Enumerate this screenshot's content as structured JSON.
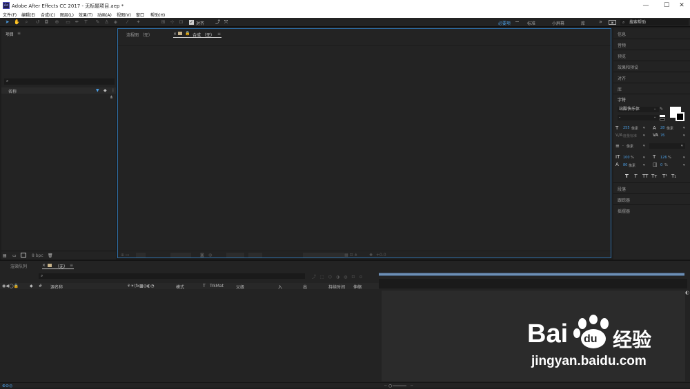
{
  "window": {
    "icon": "Ae",
    "title": "Adobe After Effects CC 2017 - 无标题项目.aep *",
    "min": "—",
    "max": "☐",
    "close": "✕"
  },
  "menu": [
    "文件(F)",
    "编辑(E)",
    "合成(C)",
    "图层(L)",
    "效果(T)",
    "动画(A)",
    "视图(V)",
    "窗口",
    "帮助(H)"
  ],
  "toolbar": {
    "align_label": "对齐",
    "workspaces": [
      "必要项",
      "标准",
      "小屏幕",
      "库"
    ],
    "search": "搜索帮助",
    "overflow": "»"
  },
  "project": {
    "title": "项目",
    "col_name": "名称",
    "bpc": "8 bpc"
  },
  "viewer": {
    "tab_flow": "流程图 （无）",
    "tab_comp": "合成 （无）",
    "zoom_readout": "+0.0"
  },
  "right": {
    "items": [
      "信息",
      "音频",
      "预览",
      "效果和预设",
      "对齐",
      "库"
    ],
    "char_title": "字符",
    "font_name": "站酷快乐体",
    "font_style": "-",
    "size_val": "255",
    "size_unit": "像素",
    "leading_val": "28",
    "leading_unit": "像素",
    "kerning_label": "度量标准",
    "tracking_val": "76",
    "stroke_unit": "像素",
    "vscale": "100",
    "hscale": "126",
    "pct": "%",
    "baseline": "80",
    "baseline_unit": "像素",
    "tsume": "0",
    "bottom_items": [
      "段落",
      "跟踪器",
      "摇摆器"
    ],
    "colors": {
      "fill": "#ffffff",
      "stroke": "#000000",
      "accent": "#4a9fe6"
    }
  },
  "timeline": {
    "tab_render": "渲染队列",
    "tab_comp": "（无）",
    "headers": [
      "源名称",
      "模式",
      "T",
      "TrkMat",
      "父级",
      "入",
      "出",
      "持续时间",
      "伸缩"
    ]
  },
  "watermark": {
    "brand": "Bai",
    "brand2": "du",
    "cn": "经验",
    "url": "jingyan.baidu.com"
  }
}
